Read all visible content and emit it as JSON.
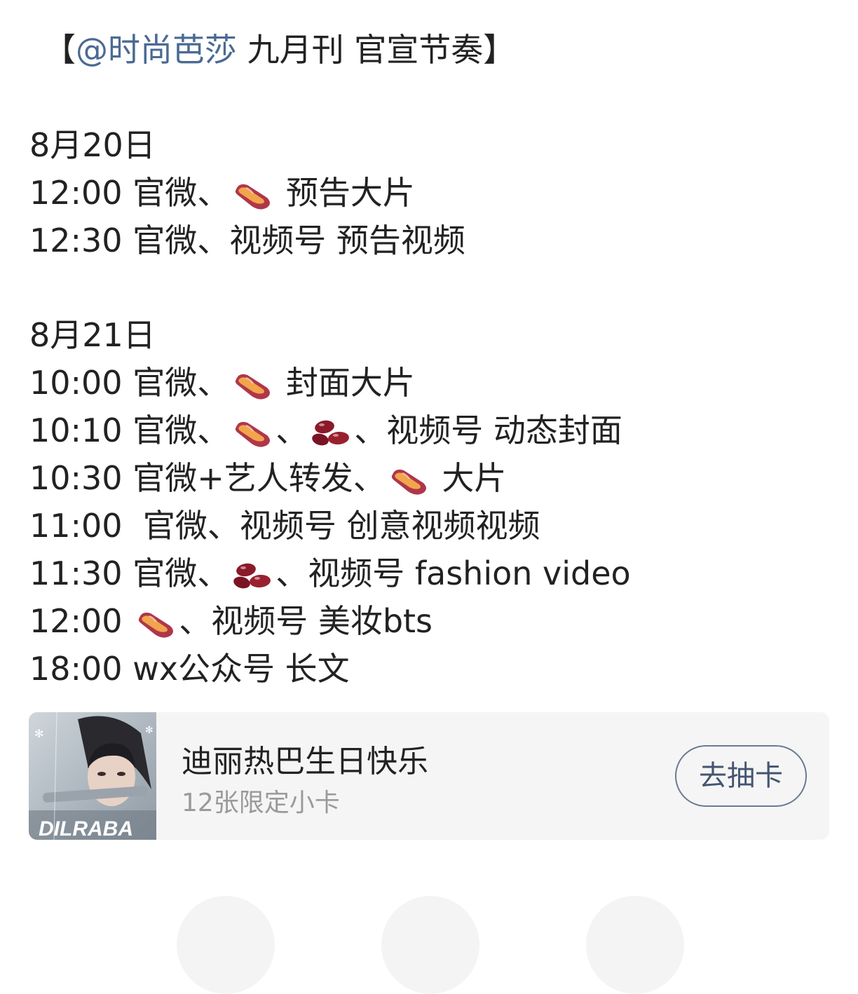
{
  "header_partial": "……",
  "post": {
    "title_prefix": "【",
    "mention": "@时尚芭莎",
    "title_suffix": " 九月刊 官宣节奏】",
    "sections": [
      {
        "date": "8月20日",
        "entries": [
          {
            "time": "12:00",
            "parts": [
              {
                "t": "text",
                "v": " 官微、"
              },
              {
                "t": "sweetpotato"
              },
              {
                "t": "text",
                "v": " 预告大片"
              }
            ]
          },
          {
            "time": "12:30",
            "parts": [
              {
                "t": "text",
                "v": " 官微、视频号 预告视频"
              }
            ]
          }
        ]
      },
      {
        "date": "8月21日",
        "entries": [
          {
            "time": "10:00",
            "parts": [
              {
                "t": "text",
                "v": " 官微、"
              },
              {
                "t": "sweetpotato"
              },
              {
                "t": "text",
                "v": " 封面大片"
              }
            ]
          },
          {
            "time": "10:10",
            "parts": [
              {
                "t": "text",
                "v": " 官微、"
              },
              {
                "t": "sweetpotato"
              },
              {
                "t": "text",
                "v": "、"
              },
              {
                "t": "beans"
              },
              {
                "t": "text",
                "v": "、视频号 动态封面"
              }
            ]
          },
          {
            "time": "10:30",
            "parts": [
              {
                "t": "text",
                "v": " 官微+艺人转发、"
              },
              {
                "t": "sweetpotato"
              },
              {
                "t": "text",
                "v": " 大片"
              }
            ]
          },
          {
            "time": "11:00",
            "parts": [
              {
                "t": "text",
                "v": "  官微、视频号 创意视频视频"
              }
            ]
          },
          {
            "time": "11:30",
            "parts": [
              {
                "t": "text",
                "v": " 官微、"
              },
              {
                "t": "beans"
              },
              {
                "t": "text",
                "v": "、视频号 fashion video"
              }
            ]
          },
          {
            "time": "12:00",
            "parts": [
              {
                "t": "text",
                "v": " "
              },
              {
                "t": "sweetpotato"
              },
              {
                "t": "text",
                "v": "、视频号 美妆bts"
              }
            ]
          },
          {
            "time": "18:00",
            "parts": [
              {
                "t": "text",
                "v": " wx公众号 长文"
              }
            ]
          }
        ]
      }
    ]
  },
  "card": {
    "title": "迪丽热巴生日快乐",
    "subtitle": "12张限定小卡",
    "button_label": "去抽卡",
    "thumb_text": "DILRABA"
  },
  "colors": {
    "mention": "#4a6a94",
    "card_bg": "#f5f5f5",
    "button_border": "#6a7a92"
  },
  "icons": {
    "sweetpotato": "sweet-potato-icon",
    "beans": "beans-icon"
  }
}
